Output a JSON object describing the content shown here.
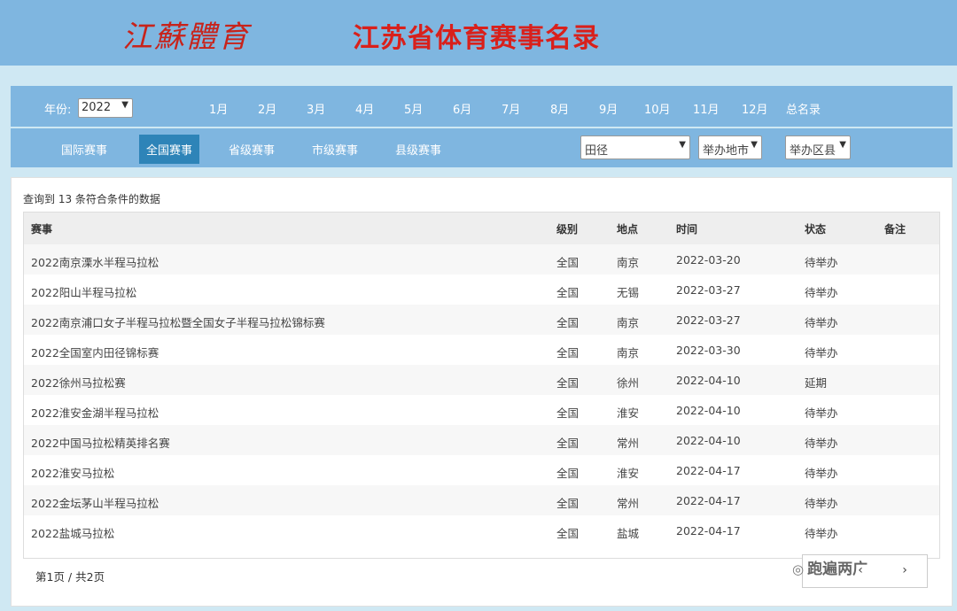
{
  "header": {
    "logo_text": "江蘇體育",
    "title": "江苏省体育赛事名录"
  },
  "filters": {
    "year_label": "年份:",
    "year_value": "2022",
    "months": [
      "1月",
      "2月",
      "3月",
      "4月",
      "5月",
      "6月",
      "7月",
      "8月",
      "9月",
      "10月",
      "11月",
      "12月"
    ],
    "all_label": "总名录",
    "categories": [
      "国际赛事",
      "全国赛事",
      "省级赛事",
      "市级赛事",
      "县级赛事"
    ],
    "active_category": "全国赛事",
    "sport_value": "田径",
    "city_value": "举办地市",
    "district_value": "举办区县"
  },
  "result_text": "查询到 13 条符合条件的数据",
  "table": {
    "headers": {
      "name": "赛事",
      "level": "级别",
      "place": "地点",
      "time": "时间",
      "status": "状态",
      "note": "备注"
    },
    "rows": [
      {
        "name": "2022南京溧水半程马拉松",
        "level": "全国",
        "place": "南京",
        "time": "2022-03-20",
        "status": "待举办"
      },
      {
        "name": "2022阳山半程马拉松",
        "level": "全国",
        "place": "无锡",
        "time": "2022-03-27",
        "status": "待举办"
      },
      {
        "name": "2022南京浦口女子半程马拉松暨全国女子半程马拉松锦标赛",
        "level": "全国",
        "place": "南京",
        "time": "2022-03-27",
        "status": "待举办"
      },
      {
        "name": "2022全国室内田径锦标赛",
        "level": "全国",
        "place": "南京",
        "time": "2022-03-30",
        "status": "待举办"
      },
      {
        "name": "2022徐州马拉松赛",
        "level": "全国",
        "place": "徐州",
        "time": "2022-04-10",
        "status": "延期"
      },
      {
        "name": "2022淮安金湖半程马拉松",
        "level": "全国",
        "place": "淮安",
        "time": "2022-04-10",
        "status": "待举办"
      },
      {
        "name": "2022中国马拉松精英排名赛",
        "level": "全国",
        "place": "常州",
        "time": "2022-04-10",
        "status": "待举办"
      },
      {
        "name": "2022淮安马拉松",
        "level": "全国",
        "place": "淮安",
        "time": "2022-04-17",
        "status": "待举办"
      },
      {
        "name": "2022金坛茅山半程马拉松",
        "level": "全国",
        "place": "常州",
        "time": "2022-04-17",
        "status": "待举办"
      },
      {
        "name": "2022盐城马拉松",
        "level": "全国",
        "place": "盐城",
        "time": "2022-04-17",
        "status": "待举办"
      }
    ]
  },
  "pager": {
    "text": "第1页 / 共2页",
    "prev": "‹",
    "next": "›"
  },
  "watermark": "跑遍两广"
}
